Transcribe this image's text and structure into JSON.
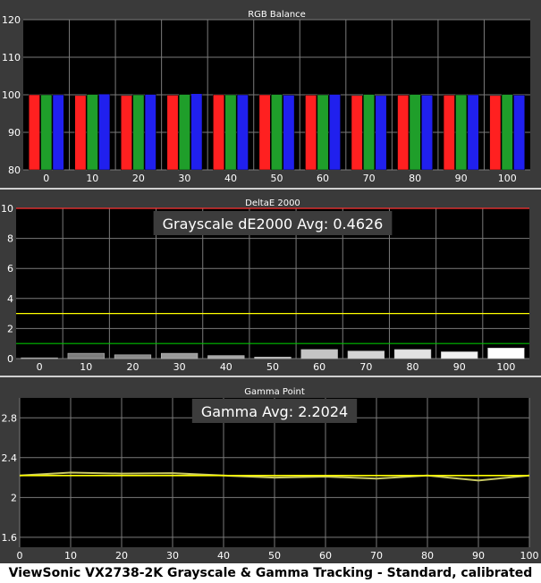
{
  "caption": "ViewSonic VX2738-2K Grayscale & Gamma Tracking - Standard, calibrated",
  "chart_data": [
    {
      "type": "bar",
      "title": "RGB Balance",
      "categories": [
        "0",
        "10",
        "20",
        "30",
        "40",
        "50",
        "60",
        "70",
        "80",
        "90",
        "100"
      ],
      "ylim": [
        80,
        120
      ],
      "yticks": [
        "80",
        "90",
        "100",
        "110",
        "120"
      ],
      "series": [
        {
          "color": "#ff2020",
          "values": [
            100.0,
            99.8,
            99.8,
            99.9,
            100.0,
            100.0,
            99.9,
            99.8,
            99.9,
            99.9,
            99.8
          ]
        },
        {
          "color": "#1f9e2a",
          "values": [
            100.0,
            100.1,
            100.0,
            100.1,
            100.0,
            100.1,
            100.0,
            100.1,
            100.1,
            100.0,
            100.1
          ]
        },
        {
          "color": "#2020ee",
          "values": [
            100.0,
            100.2,
            100.1,
            100.3,
            100.0,
            99.9,
            100.1,
            99.8,
            99.9,
            100.0,
            99.9
          ]
        }
      ],
      "grid": true
    },
    {
      "type": "bar",
      "title": "DeltaE 2000",
      "categories": [
        "0",
        "10",
        "20",
        "30",
        "40",
        "50",
        "60",
        "70",
        "80",
        "90",
        "100"
      ],
      "values": [
        0.05,
        0.35,
        0.25,
        0.35,
        0.2,
        0.1,
        0.6,
        0.5,
        0.6,
        0.45,
        0.7
      ],
      "ylim": [
        0,
        10
      ],
      "yticks": [
        "0",
        "2",
        "4",
        "6",
        "8",
        "10"
      ],
      "reference_lines": [
        {
          "value": 10,
          "color": "#ff3030"
        },
        {
          "value": 3,
          "color": "#ffff00"
        },
        {
          "value": 1,
          "color": "#00c000"
        }
      ],
      "annotation": "Grayscale dE2000 Avg: 0.4626",
      "grid": true
    },
    {
      "type": "line",
      "title": "Gamma Point",
      "x": [
        0,
        10,
        20,
        30,
        40,
        50,
        60,
        70,
        80,
        90,
        100
      ],
      "series": [
        {
          "color": "#c8c864",
          "values": [
            2.22,
            2.25,
            2.24,
            2.245,
            2.22,
            2.2,
            2.21,
            2.19,
            2.22,
            2.17,
            2.22
          ]
        },
        {
          "color": "#ffff00",
          "values": [
            2.22,
            2.22,
            2.22,
            2.22,
            2.22,
            2.22,
            2.22,
            2.22,
            2.22,
            2.22,
            2.22
          ]
        }
      ],
      "xticks": [
        "0",
        "10",
        "20",
        "30",
        "40",
        "50",
        "60",
        "70",
        "80",
        "90",
        "100"
      ],
      "ylim": [
        1.5,
        3.0
      ],
      "yticks": [
        "1.6",
        "2",
        "2.4",
        "2.8"
      ],
      "annotation": "Gamma Avg: 2.2024",
      "grid": true
    }
  ]
}
